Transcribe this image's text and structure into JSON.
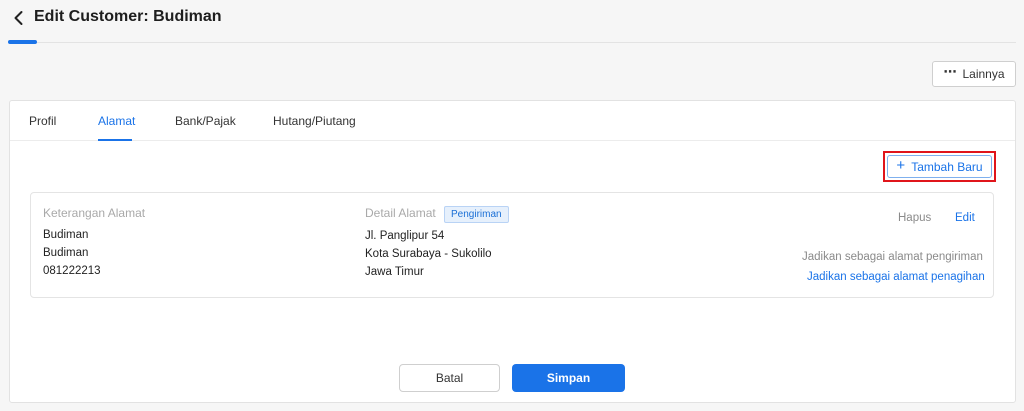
{
  "header": {
    "title": "Edit Customer: Budiman",
    "accent_color": "#1a73e8"
  },
  "toolbar": {
    "more_icon": "⋯",
    "more_label": "Lainnya"
  },
  "tabs": [
    {
      "label": "Profil",
      "active": false
    },
    {
      "label": "Alamat",
      "active": true
    },
    {
      "label": "Bank/Pajak",
      "active": false
    },
    {
      "label": "Hutang/Piutang",
      "active": false
    }
  ],
  "address_section": {
    "add_icon": "+",
    "add_label": "Tambah Baru",
    "address": {
      "description_label": "Keterangan Alamat",
      "description_lines": [
        "Budiman",
        "Budiman",
        "081222213"
      ],
      "detail_label": "Detail Alamat",
      "badge": "Pengiriman",
      "detail_lines": [
        "Jl. Panglipur 54",
        "Kota Surabaya - Sukolilo",
        "Jawa Timur"
      ],
      "delete_label": "Hapus",
      "edit_label": "Edit",
      "set_shipping_label": "Jadikan sebagai alamat pengiriman",
      "set_billing_label": "Jadikan sebagai alamat penagihan"
    }
  },
  "footer": {
    "cancel_label": "Batal",
    "save_label": "Simpan"
  }
}
